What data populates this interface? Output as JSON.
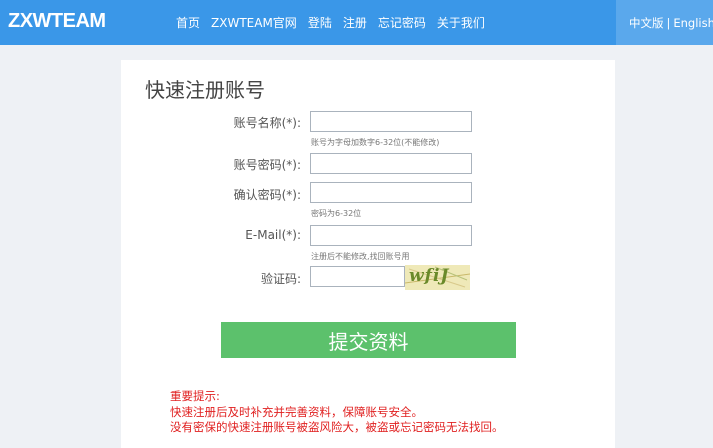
{
  "header": {
    "logo": "ZXWTEAM",
    "nav": [
      "首页",
      "ZXWTEAM官网",
      "登陆",
      "注册",
      "忘记密码",
      "关于我们"
    ],
    "lang_cn": "中文版",
    "lang_sep": "|",
    "lang_en": "English"
  },
  "form": {
    "title": "快速注册账号",
    "username_label": "账号名称(*):",
    "username_hint": "账号为字母加数字6-32位(不能修改)",
    "password_label": "账号密码(*):",
    "confirm_label": "确认密码(*):",
    "password_hint": "密码为6-32位",
    "email_label": "E-Mail(*):",
    "email_hint": "注册后不能修改,找回账号用",
    "captcha_label": "验证码:",
    "captcha_text": "wfiJ",
    "submit_label": "提交资料"
  },
  "notice": {
    "title": "重要提示:",
    "line1": "快速注册后及时补充并完善资料，保障账号安全。",
    "line2": "没有密保的快速注册账号被盗风险大，被盗或忘记密码无法找回。"
  },
  "colors": {
    "header": "#3a97e8",
    "submit": "#5cc16c",
    "notice": "#e02020"
  }
}
